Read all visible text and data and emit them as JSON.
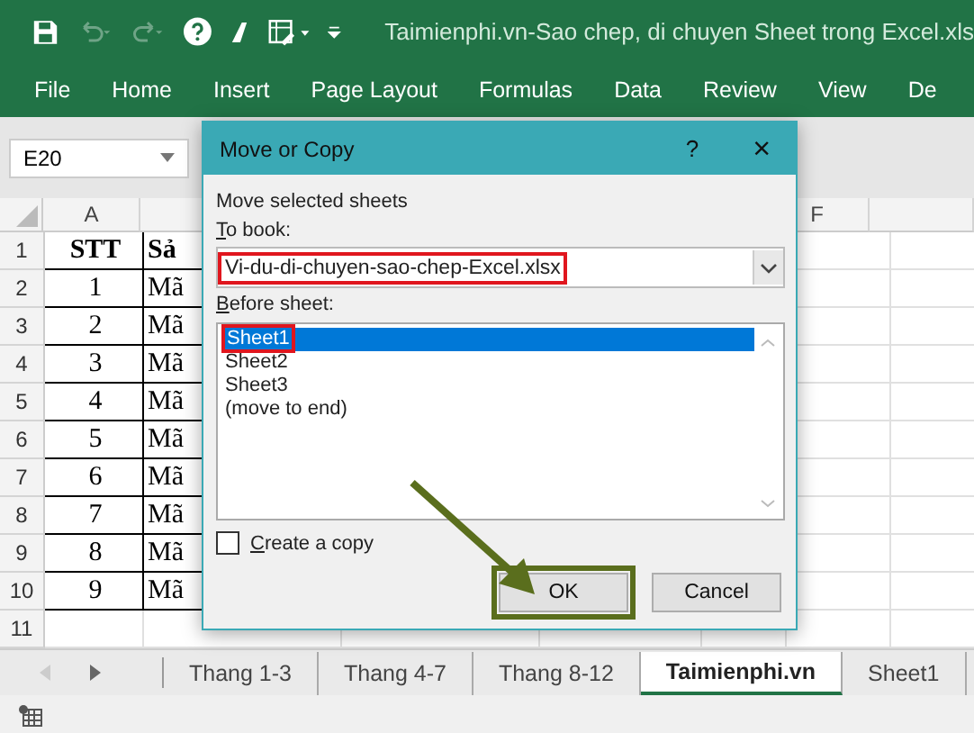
{
  "window": {
    "title": "Taimienphi.vn-Sao chep, di chuyen Sheet trong Excel.xls"
  },
  "quick_access": {
    "undo_disabled": true,
    "redo_disabled": true
  },
  "ribbon_tabs": [
    {
      "label": "File"
    },
    {
      "label": "Home"
    },
    {
      "label": "Insert"
    },
    {
      "label": "Page Layout"
    },
    {
      "label": "Formulas"
    },
    {
      "label": "Data"
    },
    {
      "label": "Review"
    },
    {
      "label": "View"
    },
    {
      "label": "De"
    }
  ],
  "name_box": {
    "value": "E20"
  },
  "columns": [
    {
      "label": "A"
    },
    {
      "label": "F"
    }
  ],
  "rows": [
    {
      "number": "1",
      "cells": [
        "STT",
        "Sả"
      ],
      "header": true
    },
    {
      "number": "2",
      "cells": [
        "1",
        "Mã"
      ],
      "header": false
    },
    {
      "number": "3",
      "cells": [
        "2",
        "Mã"
      ],
      "header": false
    },
    {
      "number": "4",
      "cells": [
        "3",
        "Mã"
      ],
      "header": false
    },
    {
      "number": "5",
      "cells": [
        "4",
        "Mã"
      ],
      "header": false
    },
    {
      "number": "6",
      "cells": [
        "5",
        "Mã"
      ],
      "header": false
    },
    {
      "number": "7",
      "cells": [
        "6",
        "Mã"
      ],
      "header": false
    },
    {
      "number": "8",
      "cells": [
        "7",
        "Mã"
      ],
      "header": false
    },
    {
      "number": "9",
      "cells": [
        "8",
        "Mã"
      ],
      "header": false
    },
    {
      "number": "10",
      "cells": [
        "9",
        "Mã"
      ],
      "header": false
    },
    {
      "number": "11"
    }
  ],
  "sheet_tabs": [
    {
      "label": "Thang 1-3",
      "selected": false
    },
    {
      "label": "Thang 4-7",
      "selected": false
    },
    {
      "label": "Thang 8-12",
      "selected": false
    },
    {
      "label": "Taimienphi.vn",
      "selected": true
    },
    {
      "label": "Sheet1",
      "selected": false
    }
  ],
  "dialog": {
    "title": "Move or Copy",
    "help": "?",
    "close": "×",
    "heading": "Move selected sheets",
    "to_book_label": "To book:",
    "to_book_value": "Vi-du-di-chuyen-sao-chep-Excel.xlsx",
    "before_sheet_label": "Before sheet:",
    "sheets": [
      {
        "label": "Sheet1",
        "selected": true
      },
      {
        "label": "Sheet2",
        "selected": false
      },
      {
        "label": "Sheet3",
        "selected": false
      },
      {
        "label": "(move to end)",
        "selected": false
      }
    ],
    "create_copy": {
      "label": "Create a copy",
      "checked": false
    },
    "buttons": [
      {
        "label": "OK",
        "kind": "default"
      },
      {
        "label": "Cancel",
        "kind": "normal"
      }
    ]
  }
}
